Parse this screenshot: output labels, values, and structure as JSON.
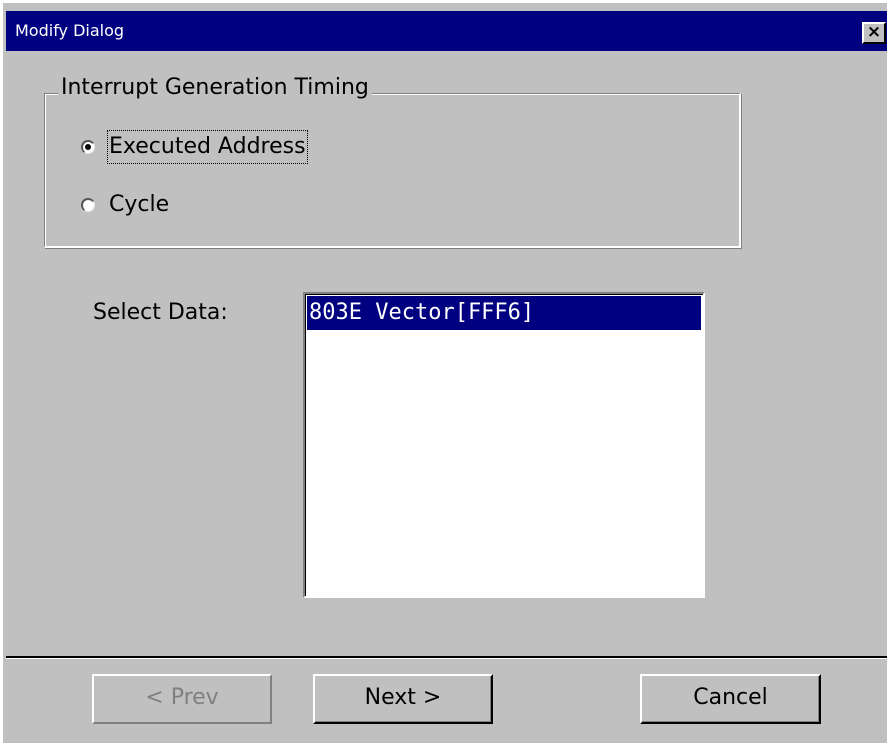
{
  "window": {
    "title": "Modify Dialog",
    "close_glyph": "×",
    "close_icon": "close-icon",
    "title_color": "#000080"
  },
  "group": {
    "legend": "Interrupt Generation Timing",
    "options": [
      {
        "label": "Executed Address",
        "checked": true
      },
      {
        "label": "Cycle",
        "checked": false
      }
    ]
  },
  "select_data": {
    "label": "Select Data:",
    "items": [
      {
        "text": "803E Vector[FFF6]",
        "selected": true
      }
    ],
    "selection_color": "#000080"
  },
  "buttons": {
    "prev": "< Prev",
    "next": "Next >",
    "cancel": "Cancel"
  }
}
